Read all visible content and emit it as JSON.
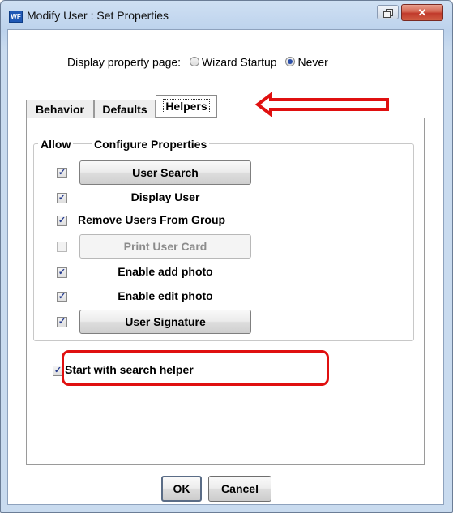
{
  "window": {
    "title": "Modify User : Set Properties",
    "app_icon_text": "WF"
  },
  "display_property": {
    "label": "Display property page:",
    "options": [
      {
        "label": "Wizard Startup",
        "selected": false
      },
      {
        "label": "Never",
        "selected": true
      }
    ]
  },
  "tabs": [
    {
      "label": "Behavior",
      "active": false
    },
    {
      "label": "Defaults",
      "active": false
    },
    {
      "label": "Helpers",
      "active": true
    }
  ],
  "group": {
    "allow_header": "Allow",
    "configure_header": "Configure Properties",
    "items": [
      {
        "label": "User Search",
        "checked": true,
        "kind": "button",
        "enabled": true
      },
      {
        "label": "Display User",
        "checked": true,
        "kind": "label"
      },
      {
        "label": "Remove Users From Group",
        "checked": true,
        "kind": "label"
      },
      {
        "label": "Print User Card",
        "checked": false,
        "kind": "button",
        "enabled": false
      },
      {
        "label": "Enable add photo",
        "checked": true,
        "kind": "label"
      },
      {
        "label": "Enable edit photo",
        "checked": true,
        "kind": "label"
      },
      {
        "label": "User Signature",
        "checked": true,
        "kind": "button",
        "enabled": true
      }
    ]
  },
  "start_with_search": {
    "label": "Start with search helper",
    "checked": true
  },
  "footer": {
    "ok_mnemonic": "O",
    "ok_rest": "K",
    "cancel_mnemonic": "C",
    "cancel_rest": "ancel"
  },
  "annotations": {
    "color": "#e01010"
  }
}
